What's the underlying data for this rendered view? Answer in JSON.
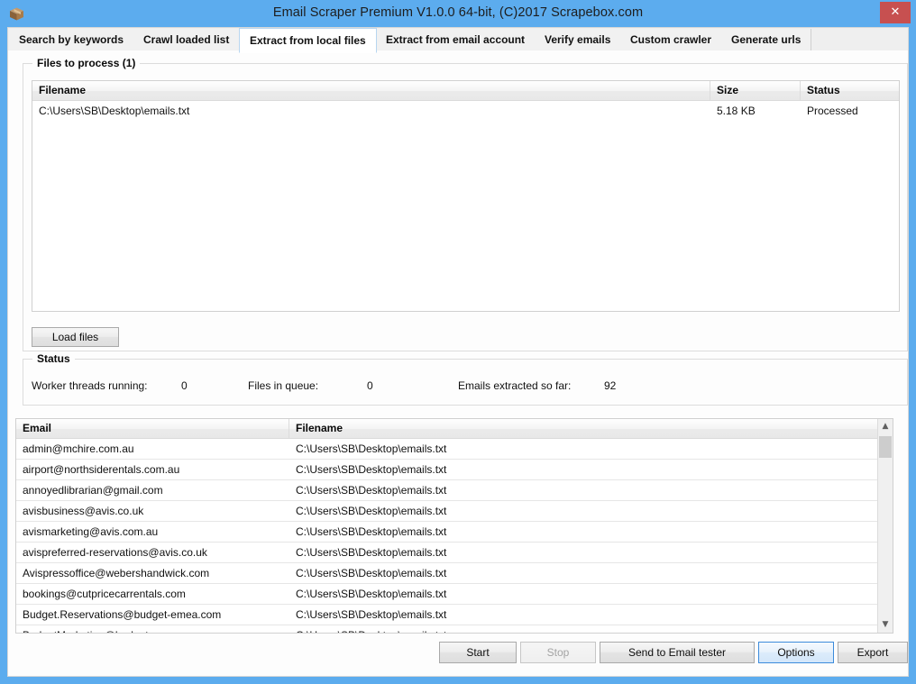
{
  "window": {
    "title": "Email Scraper Premium V1.0.0 64-bit, (C)2017 Scrapebox.com",
    "app_icon": "package-box-icon",
    "close_label": "✕",
    "titlebar_color": "#5CACEE",
    "close_button_color": "#c75050",
    "focus_accent_color": "#3c8bdb"
  },
  "tabs": [
    {
      "label": "Search by keywords",
      "active": false
    },
    {
      "label": "Crawl loaded list",
      "active": false
    },
    {
      "label": "Extract from local files",
      "active": true
    },
    {
      "label": "Extract from email account",
      "active": false
    },
    {
      "label": "Verify emails",
      "active": false
    },
    {
      "label": "Custom crawler",
      "active": false
    },
    {
      "label": "Generate urls",
      "active": false
    }
  ],
  "files_group": {
    "title": "Files to process (1)",
    "columns": [
      "Filename",
      "Size",
      "Status"
    ],
    "rows": [
      {
        "filename": "C:\\Users\\SB\\Desktop\\emails.txt",
        "size": "5.18 KB",
        "status": "Processed"
      }
    ],
    "load_files_label": "Load files"
  },
  "status_group": {
    "title": "Status",
    "fields": [
      {
        "label": "Worker threads running:",
        "value": "0"
      },
      {
        "label": "Files in queue:",
        "value": "0"
      },
      {
        "label": "Emails extracted so far:",
        "value": "92"
      }
    ]
  },
  "results": {
    "columns": [
      "Email",
      "Filename"
    ],
    "rows": [
      {
        "email": "admin@mchire.com.au",
        "filename": "C:\\Users\\SB\\Desktop\\emails.txt"
      },
      {
        "email": "airport@northsiderentals.com.au",
        "filename": "C:\\Users\\SB\\Desktop\\emails.txt"
      },
      {
        "email": "annoyedlibrarian@gmail.com",
        "filename": "C:\\Users\\SB\\Desktop\\emails.txt"
      },
      {
        "email": "avisbusiness@avis.co.uk",
        "filename": "C:\\Users\\SB\\Desktop\\emails.txt"
      },
      {
        "email": "avismarketing@avis.com.au",
        "filename": "C:\\Users\\SB\\Desktop\\emails.txt"
      },
      {
        "email": "avispreferred-reservations@avis.co.uk",
        "filename": "C:\\Users\\SB\\Desktop\\emails.txt"
      },
      {
        "email": "Avispressoffice@webershandwick.com",
        "filename": "C:\\Users\\SB\\Desktop\\emails.txt"
      },
      {
        "email": "bookings@cutpricecarrentals.com",
        "filename": "C:\\Users\\SB\\Desktop\\emails.txt"
      },
      {
        "email": "Budget.Reservations@budget-emea.com",
        "filename": "C:\\Users\\SB\\Desktop\\emails.txt"
      },
      {
        "email": "BudgetMarketing@budget.com.au",
        "filename": "C:\\Users\\SB\\Desktop\\emails.txt"
      }
    ],
    "scrollbar": {
      "up_arrow": "▲",
      "down_arrow": "▼"
    }
  },
  "footer": {
    "start_label": "Start",
    "stop_label": "Stop",
    "stop_disabled": true,
    "send_to_tester_label": "Send to Email tester",
    "options_label": "Options",
    "options_focused": true,
    "export_label": "Export"
  }
}
